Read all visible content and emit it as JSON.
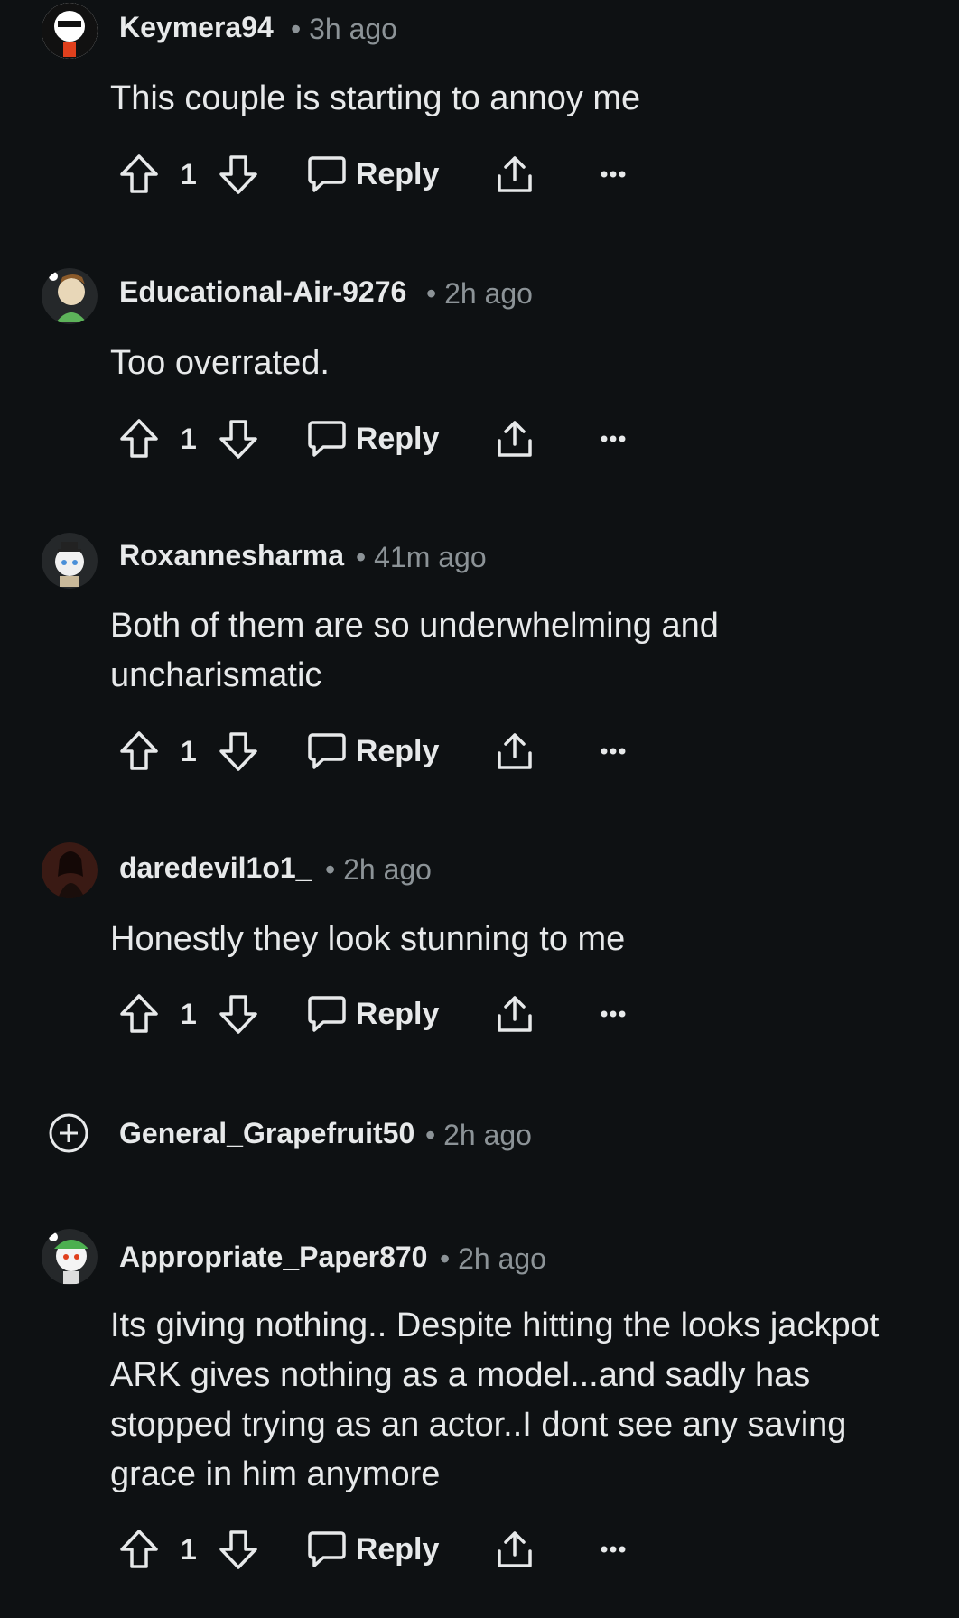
{
  "comments": [
    {
      "username": "Keymera94",
      "time": "3h ago",
      "text": "This couple is starting to annoy me",
      "votes": "1",
      "reply": "Reply",
      "avatar_color": "#1b1d1f"
    },
    {
      "username": "Educational-Air-9276",
      "time": "2h ago",
      "text": "Too overrated.",
      "votes": "1",
      "reply": "Reply",
      "avatar_color": "#2a2c2e"
    },
    {
      "username": "Roxannesharma",
      "time": "41m ago",
      "text": "Both of them are so underwhelming and uncharismatic",
      "votes": "1",
      "reply": "Reply",
      "avatar_color": "#2a2c2e"
    },
    {
      "username": "daredevil1o1_",
      "time": "2h ago",
      "text": "Honestly they look stunning to me",
      "votes": "1",
      "reply": "Reply",
      "avatar_color": "#3a1a14"
    },
    {
      "username": "General_Grapefruit50",
      "time": "2h ago",
      "collapsed": true
    },
    {
      "username": "Appropriate_Paper870",
      "time": "2h ago",
      "text": "Its giving nothing.. Despite hitting the looks jackpot ARK gives nothing as a model...and sadly has stopped trying as an actor..I dont see any saving grace in him anymore",
      "votes": "1",
      "reply": "Reply",
      "avatar_color": "#2a2c2e"
    }
  ],
  "icons": {
    "upvote": "arrow-up-icon",
    "downvote": "arrow-down-icon",
    "reply": "speech-bubble-icon",
    "share": "share-icon",
    "more": "more-dots-icon",
    "expand": "plus-circle-icon"
  },
  "colors": {
    "background": "#0e1113",
    "text": "#e7e9ea",
    "meta": "#8c9397"
  }
}
